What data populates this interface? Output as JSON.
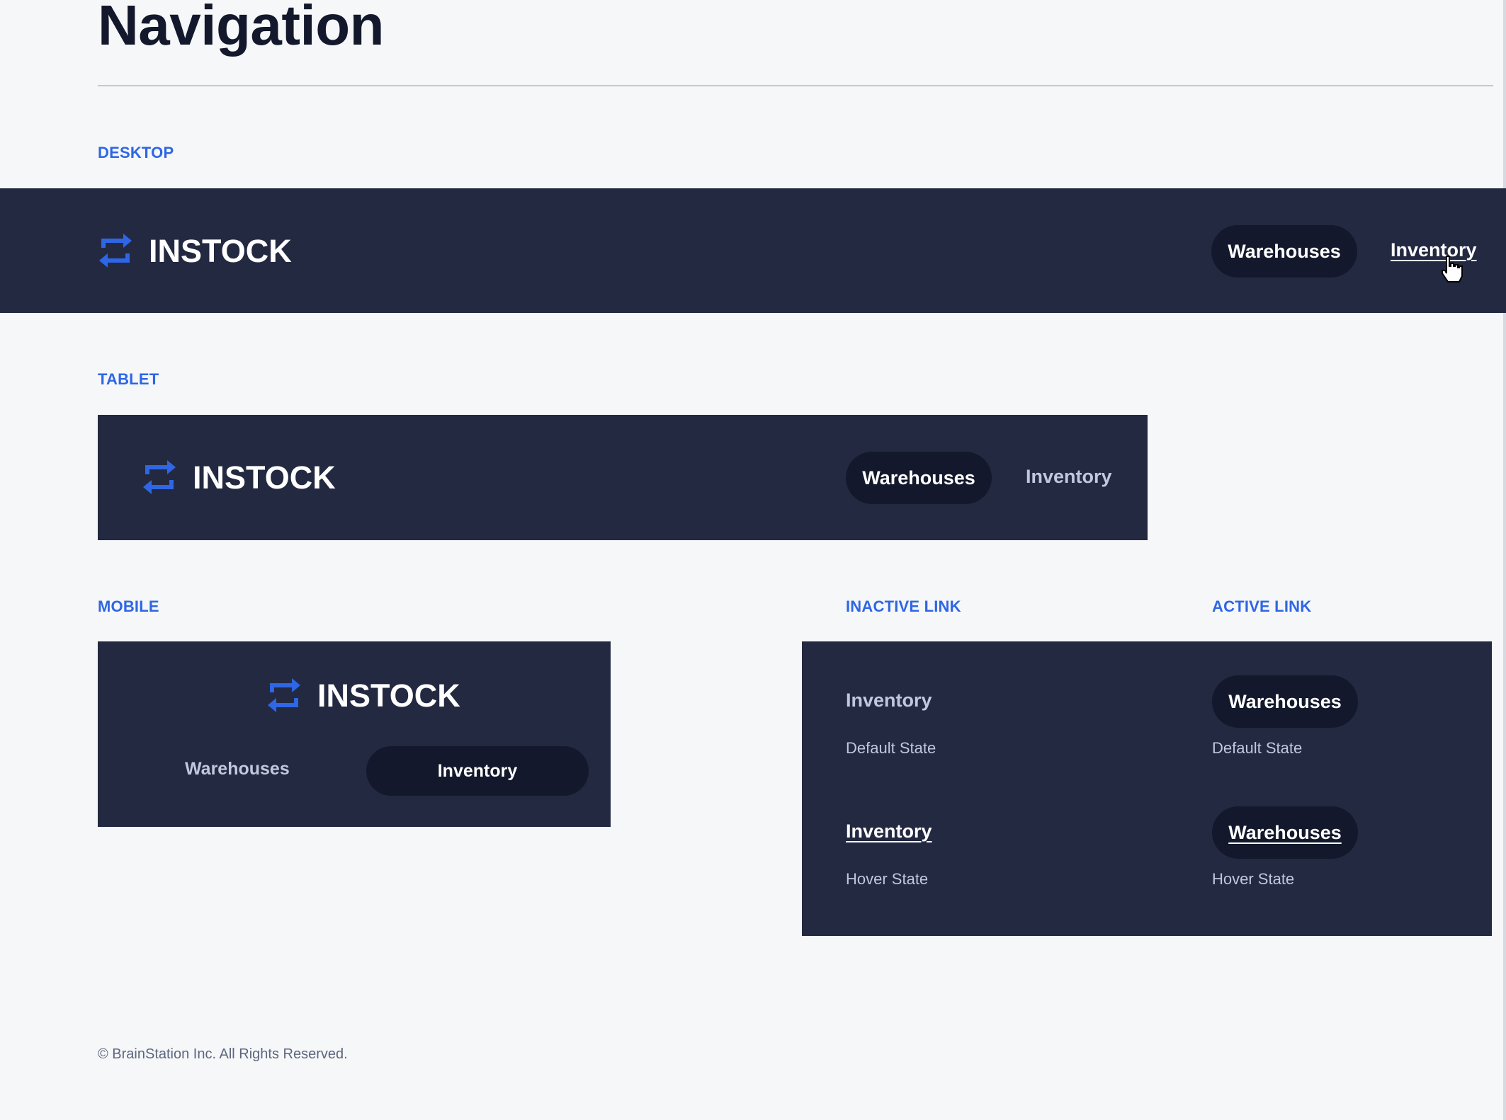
{
  "page": {
    "title": "Navigation",
    "footer": "© BrainStation Inc. All Rights Reserved."
  },
  "brand": {
    "name": "INSTOCK",
    "logo_icon": "swap-arrows-icon",
    "accent": "#2e66e5",
    "nav_bg": "#232940",
    "pill_bg": "#13182c"
  },
  "sections": {
    "desktop": "DESKTOP",
    "tablet": "TABLET",
    "mobile": "MOBILE",
    "inactive": "INACTIVE LINK",
    "active": "ACTIVE LINK"
  },
  "nav": {
    "warehouses": "Warehouses",
    "inventory": "Inventory"
  },
  "states": {
    "default": "Default State",
    "hover": "Hover State"
  }
}
